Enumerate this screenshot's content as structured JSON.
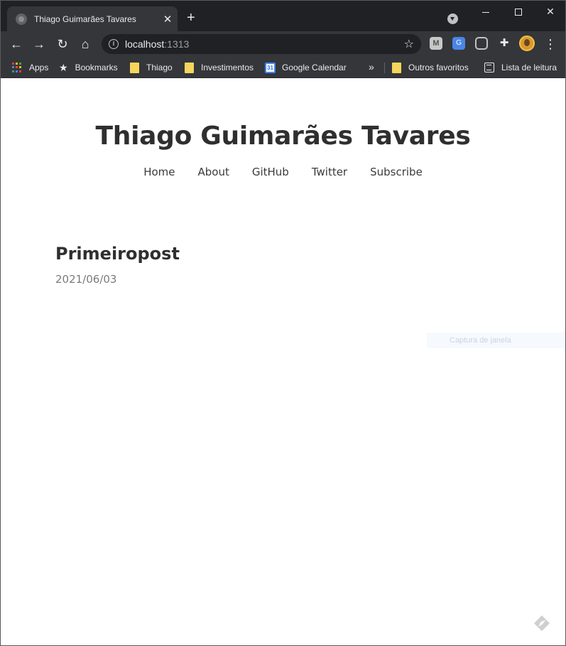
{
  "browser": {
    "tab_title": "Thiago Guimarães Tavares",
    "tab_close": "✕",
    "new_tab": "+",
    "url_host": "localhost",
    "url_port": ":1313",
    "extensions": {
      "m": "M",
      "g": "G"
    }
  },
  "bookmarks": [
    {
      "label": "Apps",
      "icon": "apps-grid-icon"
    },
    {
      "label": "Bookmarks",
      "icon": "star-icon"
    },
    {
      "label": "Thiago",
      "icon": "folder-icon"
    },
    {
      "label": "Investimentos",
      "icon": "folder-icon"
    },
    {
      "label": "Google Calendar",
      "icon": "calendar-icon"
    },
    {
      "label": "Outros favoritos",
      "icon": "folder-icon"
    },
    {
      "label": "Lista de leitura",
      "icon": "reading-list-icon"
    }
  ],
  "bookmarks_overflow": "»",
  "calendar_badge": "31",
  "site": {
    "title": "Thiago Guimarães Tavares",
    "nav": [
      "Home",
      "About",
      "GitHub",
      "Twitter",
      "Subscribe"
    ]
  },
  "post": {
    "title": "Primeiropost",
    "date": "2021/06/03"
  },
  "overlay": {
    "capture_hint": "Captura de janela"
  }
}
